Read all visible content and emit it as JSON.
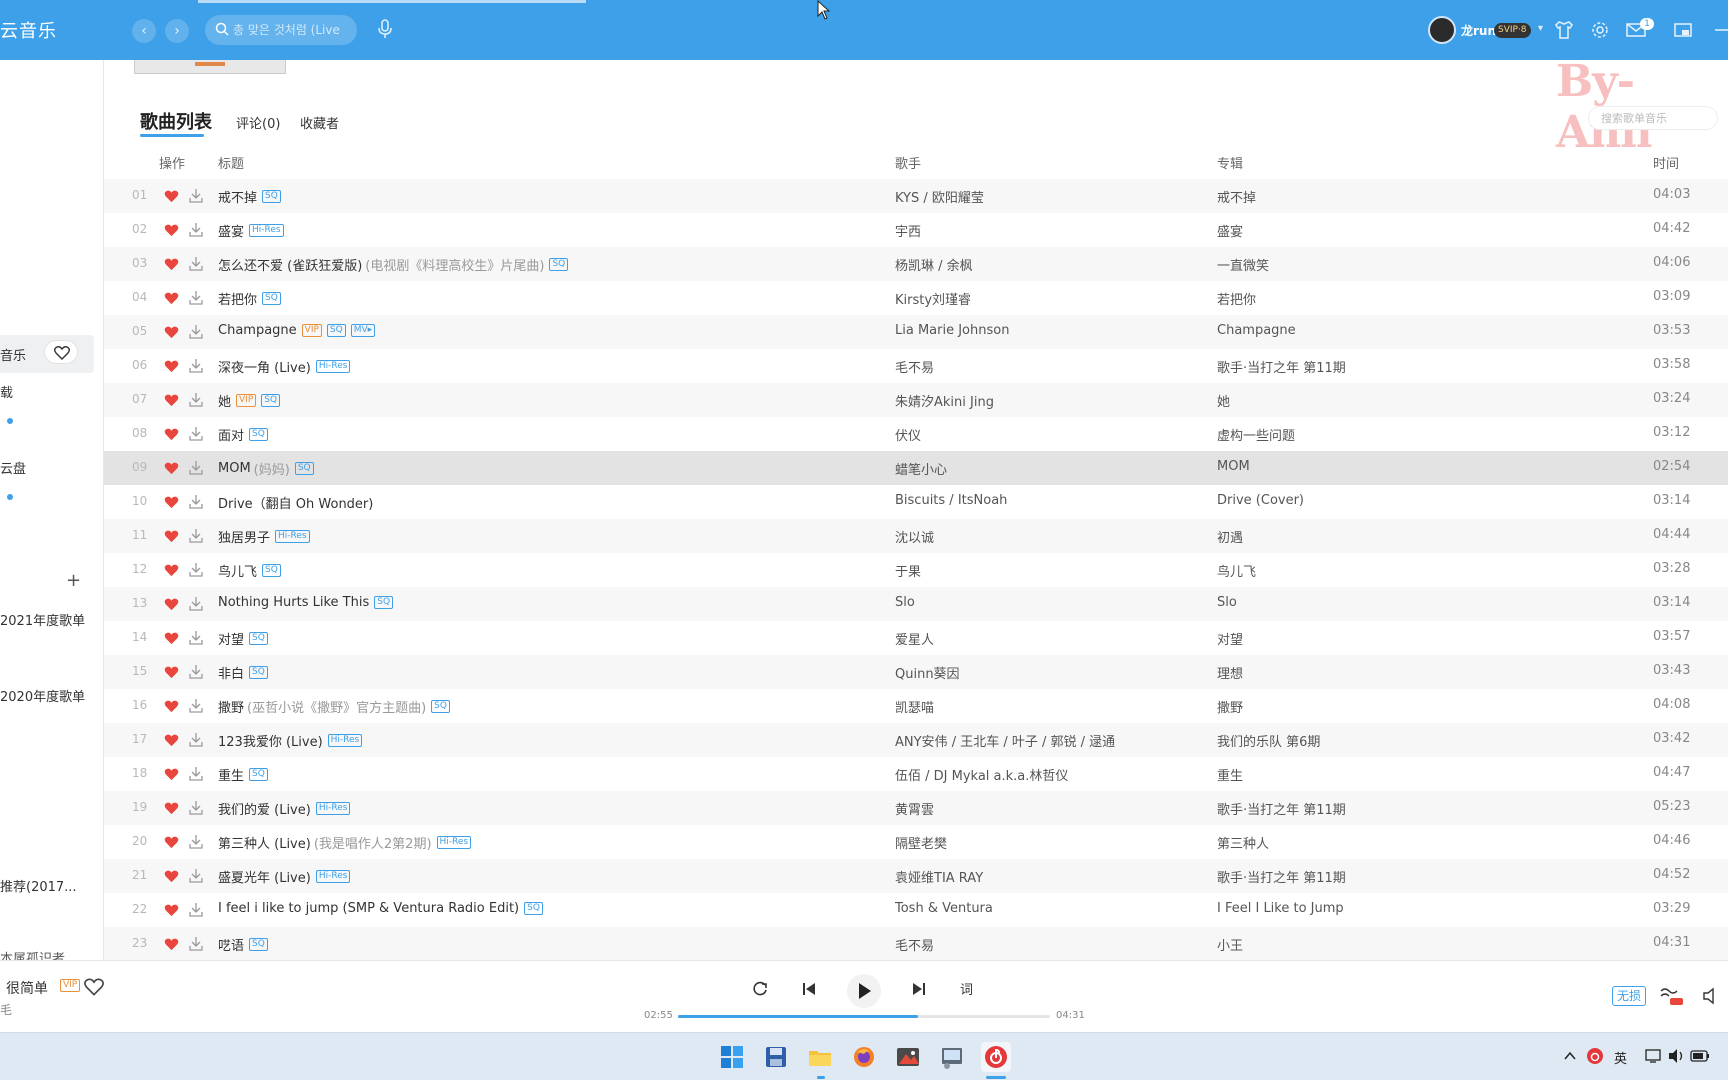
{
  "app": {
    "title": "云音乐",
    "search_placeholder": "총 맞은 것처럼 (Live"
  },
  "user": {
    "name": "龙run",
    "vip_label": "SVIP·8"
  },
  "notifications": {
    "mail_count": "1"
  },
  "sidebar": {
    "items": [
      {
        "label": "音乐"
      },
      {
        "label": "载"
      },
      {
        "label": "云盘"
      },
      {
        "label": "2021年度歌单"
      },
      {
        "label": "2020年度歌单"
      },
      {
        "label": "推荐(2017..."
      },
      {
        "label": "本属孤识者"
      }
    ]
  },
  "tabs": {
    "song_list": "歌曲列表",
    "comments": "评论(0)",
    "collectors": "收藏者"
  },
  "list_search_placeholder": "搜索歌单音乐",
  "watermark": "By-Anli",
  "columns": {
    "ops": "操作",
    "title": "标题",
    "artist": "歌手",
    "album": "专辑",
    "time": "时间"
  },
  "songs": [
    {
      "num": "01",
      "title": "戒不掉",
      "sub": "",
      "tags": [
        "SQ"
      ],
      "artist": "KYS / 欧阳耀莹",
      "album": "戒不掉",
      "time": "04:03"
    },
    {
      "num": "02",
      "title": "盛宴",
      "sub": "",
      "tags": [
        "Hi-Res"
      ],
      "artist": "宇西",
      "album": "盛宴",
      "time": "04:42"
    },
    {
      "num": "03",
      "title": "怎么还不爱 (雀跃狂爱版)",
      "sub": "(电视剧《料理高校生》片尾曲)",
      "tags": [
        "SQ"
      ],
      "artist": "杨凯琳 / 余枫",
      "album": "一直微笑",
      "time": "04:06"
    },
    {
      "num": "04",
      "title": "若把你",
      "sub": "",
      "tags": [
        "SQ"
      ],
      "artist": "Kirsty刘瑾睿",
      "album": "若把你",
      "time": "03:09"
    },
    {
      "num": "05",
      "title": "Champagne",
      "sub": "",
      "tags": [
        "VIP",
        "SQ",
        "MV▸"
      ],
      "artist": "Lia Marie Johnson",
      "album": "Champagne",
      "time": "03:53"
    },
    {
      "num": "06",
      "title": "深夜一角 (Live)",
      "sub": "",
      "tags": [
        "Hi-Res"
      ],
      "artist": "毛不易",
      "album": "歌手·当打之年 第11期",
      "time": "03:58"
    },
    {
      "num": "07",
      "title": "她",
      "sub": "",
      "tags": [
        "VIP",
        "SQ"
      ],
      "artist": "朱婧汐Akini Jing",
      "album": "她",
      "time": "03:24"
    },
    {
      "num": "08",
      "title": "面对",
      "sub": "",
      "tags": [
        "SQ"
      ],
      "artist": "伏仪",
      "album": "虚构一些问题",
      "time": "03:12"
    },
    {
      "num": "09",
      "title": "MOM",
      "sub": "(妈妈)",
      "tags": [
        "SQ"
      ],
      "artist": "蜡笔小心",
      "album": "MOM",
      "time": "02:54"
    },
    {
      "num": "10",
      "title": "Drive（翻自 Oh Wonder)",
      "sub": "",
      "tags": [],
      "artist": "Biscuits / ItsNoah",
      "album": "Drive (Cover)",
      "time": "03:14"
    },
    {
      "num": "11",
      "title": "独居男子",
      "sub": "",
      "tags": [
        "Hi-Res"
      ],
      "artist": "沈以诚",
      "album": "初遇",
      "time": "04:44"
    },
    {
      "num": "12",
      "title": "鸟儿飞",
      "sub": "",
      "tags": [
        "SQ"
      ],
      "artist": "于果",
      "album": "鸟儿飞",
      "time": "03:28"
    },
    {
      "num": "13",
      "title": "Nothing Hurts Like This",
      "sub": "",
      "tags": [
        "SQ"
      ],
      "artist": "Slo",
      "album": "Slo",
      "time": "03:14"
    },
    {
      "num": "14",
      "title": "对望",
      "sub": "",
      "tags": [
        "SQ"
      ],
      "artist": "爱星人",
      "album": "对望",
      "time": "03:57"
    },
    {
      "num": "15",
      "title": "非白",
      "sub": "",
      "tags": [
        "SQ"
      ],
      "artist": "Quinn葵因",
      "album": "理想",
      "time": "03:43"
    },
    {
      "num": "16",
      "title": "撒野",
      "sub": "(巫哲小说《撒野》官方主题曲)",
      "tags": [
        "SQ"
      ],
      "artist": "凯瑟喵",
      "album": "撒野",
      "time": "04:08"
    },
    {
      "num": "17",
      "title": "123我爱你 (Live)",
      "sub": "",
      "tags": [
        "Hi-Res"
      ],
      "artist": "ANY安伟 / 王北车 / 叶子 / 郭锐 / 逯通",
      "album": "我们的乐队 第6期",
      "time": "03:42"
    },
    {
      "num": "18",
      "title": "重生",
      "sub": "",
      "tags": [
        "SQ"
      ],
      "artist": "伍佰 / DJ Mykal a.k.a.林哲仪",
      "album": "重生",
      "time": "04:47"
    },
    {
      "num": "19",
      "title": "我们的爱 (Live)",
      "sub": "",
      "tags": [
        "Hi-Res"
      ],
      "artist": "黄霄雲",
      "album": "歌手·当打之年 第11期",
      "time": "05:23"
    },
    {
      "num": "20",
      "title": "第三种人 (Live)",
      "sub": "(我是唱作人2第2期)",
      "tags": [
        "Hi-Res"
      ],
      "artist": "隔壁老樊",
      "album": "第三种人",
      "time": "04:46"
    },
    {
      "num": "21",
      "title": "盛夏光年 (Live)",
      "sub": "",
      "tags": [
        "Hi-Res"
      ],
      "artist": "袁娅维TIA RAY",
      "album": "歌手·当打之年 第11期",
      "time": "04:52"
    },
    {
      "num": "22",
      "title": "I feel i like to jump (SMP & Ventura Radio Edit)",
      "sub": "",
      "tags": [
        "SQ"
      ],
      "artist": "Tosh & Ventura",
      "album": "I Feel I Like to Jump",
      "time": "03:29"
    },
    {
      "num": "23",
      "title": "呓语",
      "sub": "",
      "tags": [
        "SQ"
      ],
      "artist": "毛不易",
      "album": "小王",
      "time": "04:31"
    }
  ],
  "selected_row": 8,
  "player": {
    "now_title": "很简单",
    "now_tag": "VIP",
    "now_artist": "毛",
    "current_time": "02:55",
    "total_time": "04:31",
    "progress": 0.645,
    "lyric_label": "词",
    "quality_label": "无损"
  },
  "taskbar": {
    "ime": "英"
  },
  "colors": {
    "accent": "#3ea0e8",
    "heart": "#e8453c",
    "vip": "#e8903a"
  }
}
